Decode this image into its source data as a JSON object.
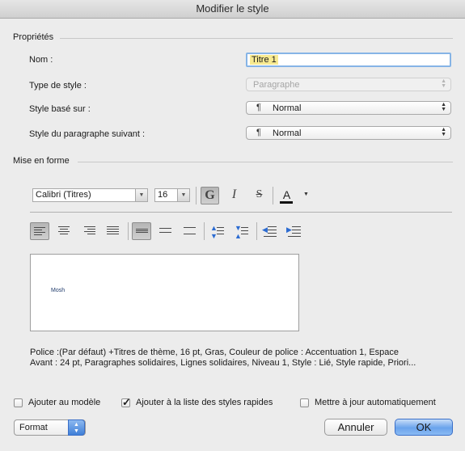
{
  "window": {
    "title": "Modifier le style"
  },
  "properties": {
    "section_title": "Propriétés",
    "name_label": "Nom :",
    "name_value": "Titre 1",
    "type_label": "Type de style :",
    "type_value": "Paragraphe",
    "based_label": "Style basé sur :",
    "based_value": "Normal",
    "next_label": "Style du paragraphe suivant :",
    "next_value": "Normal",
    "pilcrow": "¶"
  },
  "formatting": {
    "section_title": "Mise en forme",
    "font": "Calibri (Titres)",
    "size": "16",
    "bold": "G",
    "italic": "I",
    "strike": "S",
    "color_letter": "A",
    "text_color": "#1f3a6b"
  },
  "preview": {
    "text": "Mosh"
  },
  "description": {
    "line1": "Police :(Par défaut) +Titres de thème, 16 pt, Gras, Couleur de police : Accentuation 1, Espace",
    "line2": "Avant :  24 pt, Paragraphes solidaires, Lignes solidaires, Niveau 1, Style : Lié, Style rapide, Priori..."
  },
  "options": {
    "add_to_template": {
      "label": "Ajouter au modèle",
      "checked": false
    },
    "add_to_quick_styles": {
      "label": "Ajouter à la liste des styles rapides",
      "checked": true
    },
    "auto_update": {
      "label": "Mettre à jour automatiquement",
      "checked": false
    }
  },
  "footer": {
    "format_label": "Format",
    "cancel_label": "Annuler",
    "ok_label": "OK"
  },
  "colors": {
    "accent": "#3f7fd8",
    "focus_ring": "#86b4e6",
    "selection": "#f7ea91"
  }
}
